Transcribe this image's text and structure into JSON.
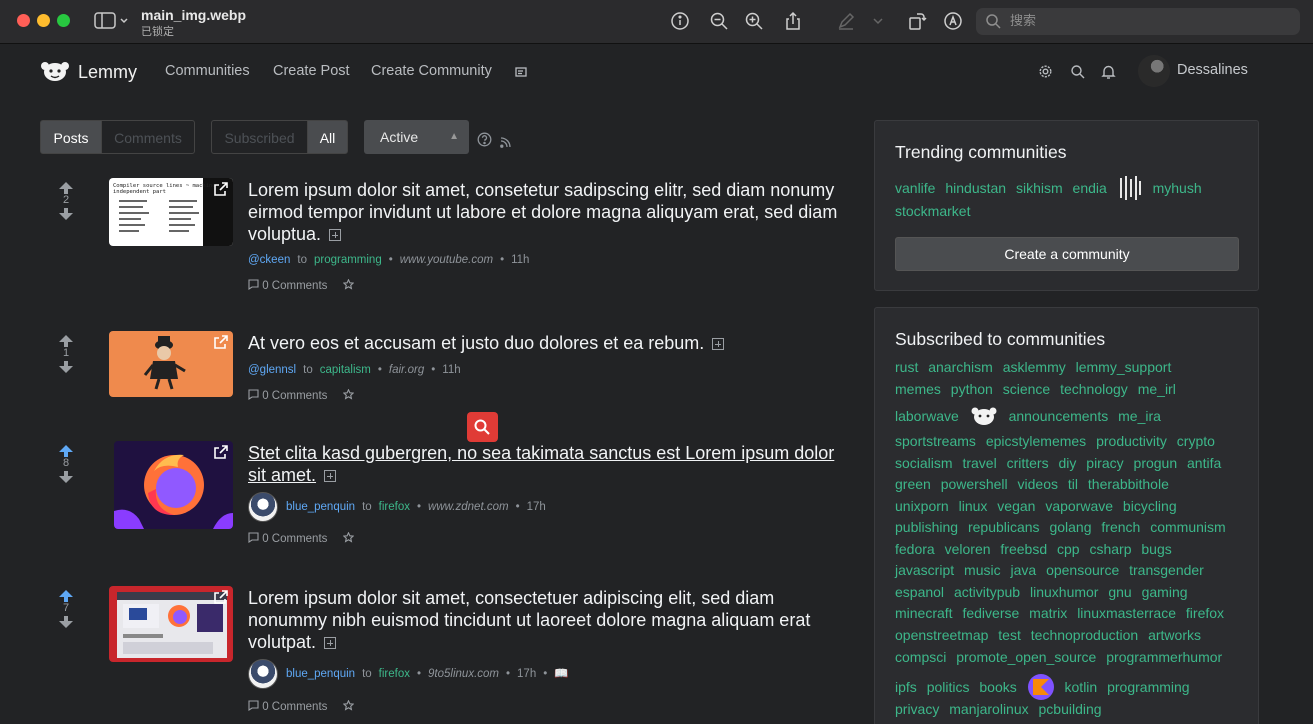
{
  "window": {
    "title": "main_img.webp",
    "subtitle": "已锁定",
    "search_placeholder": "搜索"
  },
  "nav": {
    "brand": "Lemmy",
    "links": [
      "Communities",
      "Create Post",
      "Create Community"
    ],
    "username": "Dessalines"
  },
  "filters": {
    "type_tabs": [
      "Posts",
      "Comments"
    ],
    "listing_tabs": [
      "Subscribed",
      "All"
    ],
    "sort": "Active"
  },
  "posts": [
    {
      "score": "2",
      "title": "Lorem ipsum dolor sit amet, consetetur sadipscing elitr, sed diam nonumy eirmod tempor invidunt ut labore et dolore magna aliquyam erat, sed diam voluptua.",
      "user": "@ckeen",
      "to": "to",
      "community": "programming",
      "domain": "www.youtube.com",
      "time": "11h",
      "comments": "0 Comments"
    },
    {
      "score": "1",
      "title": "At vero eos et accusam et justo duo dolores et ea rebum.",
      "user": "@glennsl",
      "to": "to",
      "community": "capitalism",
      "domain": "fair.org",
      "time": "11h",
      "comments": "0 Comments"
    },
    {
      "score": "8",
      "title": "Stet clita kasd gubergren, no sea takimata sanctus est Lorem ipsum dolor sit amet.",
      "user": "blue_penquin",
      "to": "to",
      "community": "firefox",
      "domain": "www.zdnet.com",
      "time": "17h",
      "comments": "0 Comments"
    },
    {
      "score": "7",
      "title": "Lorem ipsum dolor sit amet, consectetuer adipiscing elit, sed diam nonummy nibh euismod tincidunt ut laoreet dolore magna aliquam erat volutpat.",
      "user": "blue_penquin",
      "to": "to",
      "community": "firefox",
      "domain": "9to5linux.com",
      "time": "17h",
      "comments": "0 Comments"
    }
  ],
  "trending": {
    "title": "Trending communities",
    "line1": [
      "vanlife",
      "hindustan",
      "sikhism",
      "endia",
      "myhush"
    ],
    "line2": [
      "stockmarket"
    ],
    "create_label": "Create a community"
  },
  "subscribed": {
    "title": "Subscribed to communities",
    "lines": [
      [
        "rust",
        "anarchism",
        "asklemmy",
        "lemmy_support"
      ],
      [
        "memes",
        "python",
        "science",
        "technology",
        "me_irl"
      ],
      [
        "laborwave",
        "announcements",
        "me_ira"
      ],
      [
        "sportstreams",
        "epicstylememes",
        "productivity",
        "crypto"
      ],
      [
        "socialism",
        "travel",
        "critters",
        "diy",
        "piracy",
        "progun",
        "antifa"
      ],
      [
        "green",
        "powershell",
        "videos",
        "til",
        "therabbithole"
      ],
      [
        "unixporn",
        "linux",
        "vegan",
        "vaporwave",
        "bicycling"
      ],
      [
        "publishing",
        "republicans",
        "golang",
        "french",
        "communism"
      ],
      [
        "fedora",
        "veloren",
        "freebsd",
        "cpp",
        "csharp",
        "bugs"
      ],
      [
        "javascript",
        "music",
        "java",
        "opensource",
        "transgender"
      ],
      [
        "espanol",
        "activitypub",
        "linuxhumor",
        "gnu",
        "gaming"
      ],
      [
        "minecraft",
        "fediverse",
        "matrix",
        "linuxmasterrace",
        "firefox"
      ],
      [
        "openstreetmap",
        "test",
        "technoproduction",
        "artworks"
      ],
      [
        "compsci",
        "promote_open_source",
        "programmerhumor"
      ],
      [
        "ipfs",
        "politics",
        "books",
        "kotlin",
        "programming"
      ],
      [
        "privacy",
        "manjarolinux",
        "pcbuilding"
      ]
    ]
  },
  "colors": {
    "accent_green": "#3db78a",
    "accent_blue": "#5fa8f5",
    "background": "#222325",
    "card": "#2b2c2f"
  }
}
